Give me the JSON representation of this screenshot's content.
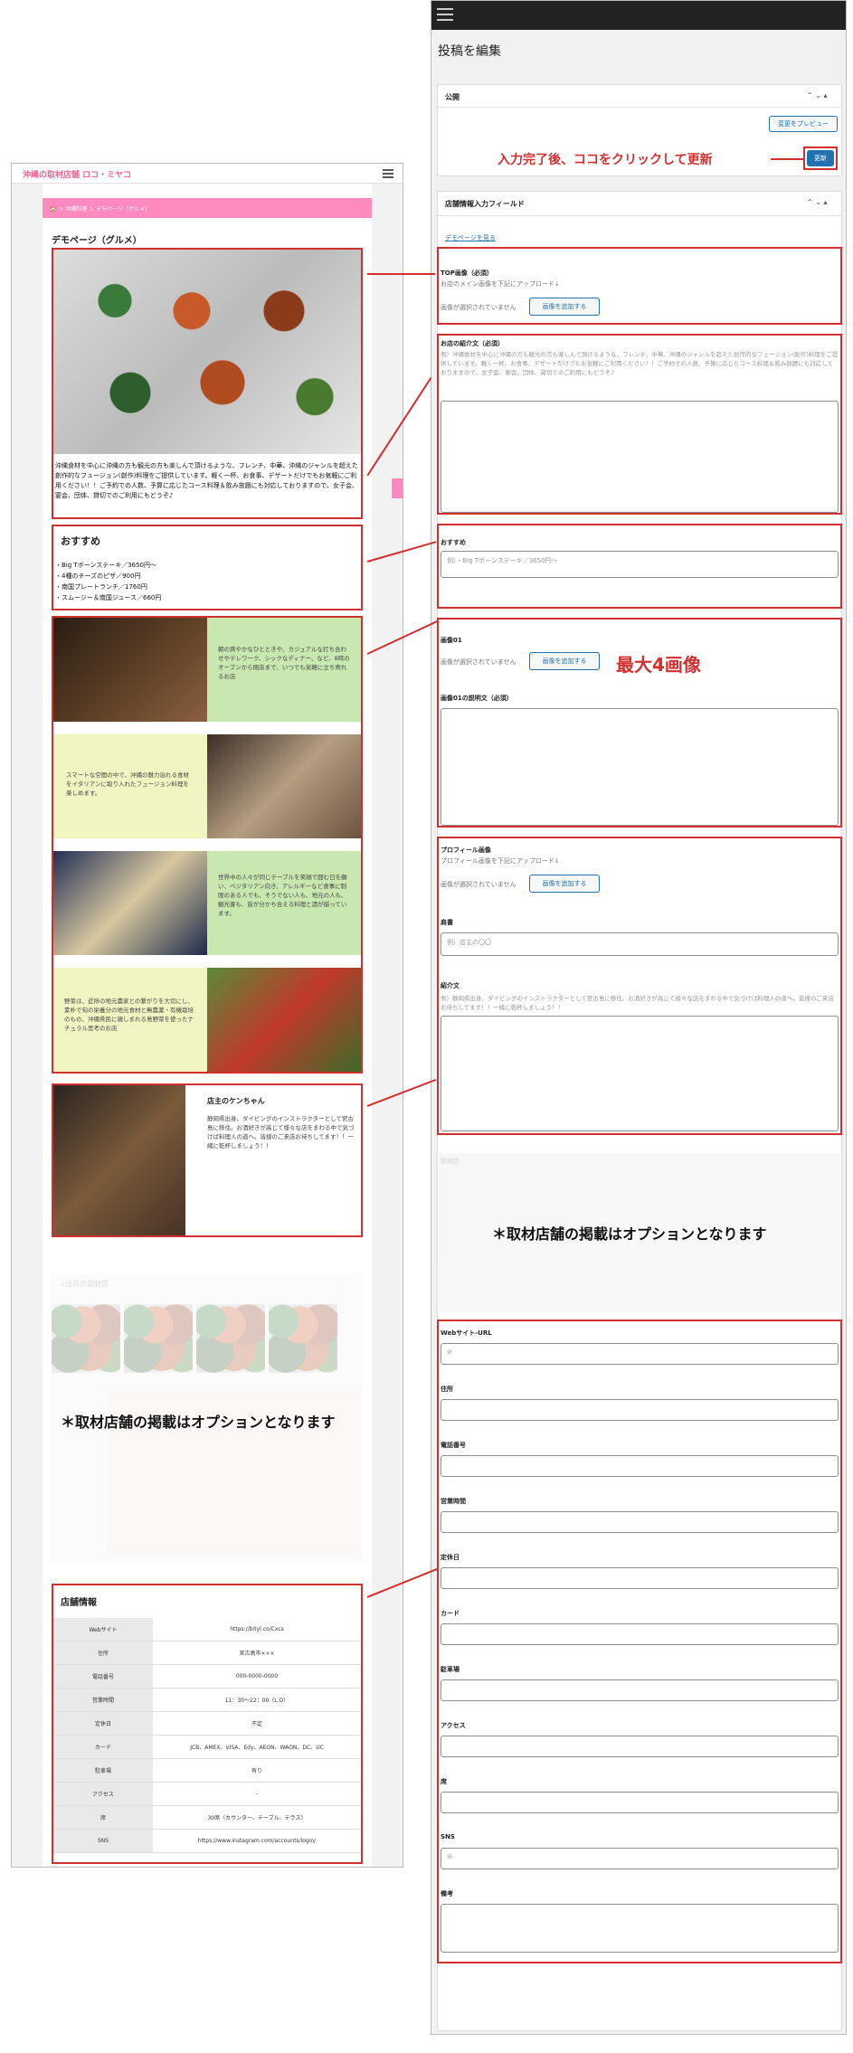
{
  "preview": {
    "logo": "沖縄の取材店舗 ロコ・ミヤコ",
    "breadcrumb": "🏠 ＞ 沖縄料理 ＞ デモページ（グルメ）",
    "page_title": "デモページ（グルメ）",
    "intro": "沖縄食材を中心に沖縄の方も観光の方も楽しんで頂けるような、フレンチ、中華、沖縄のジャンルを超えた創作的なフュージョン(創作)料理をご提供しています。軽く一杯、お食事、デザートだけでもお気軽にご利用ください！！ご予約での人数、予算に応じたコース料理＆飲み放題にも対応しておりますので、女子会、宴会、団体、貸切でのご利用にもどうぞ♪",
    "recommend_title": "おすすめ",
    "recommend_lines": [
      "・Big Tボーンステーキ／3650円～",
      "・4種のチーズのピザ／900円",
      "・南国プレートランチ／1760円",
      "・スムージー＆南国ジュース／660円"
    ],
    "gallery_texts": [
      "朝の爽やかなひとときや、カジュアルな打ち合わせやテレワーク、シックなディナー、など、8時のオープンから閉店まで、いつでも気軽に立ち寄れるお店",
      "スマートな空間の中で、沖縄の魅力溢れる食材をイタリアンに取り入れたフュージョン料理を楽しめます。",
      "世界中の人々が同じテーブルを笑顔で囲む日を願い、ベジタリアン向き、アレルギーなど食事に制限のある人でも、そうでない人も、地元の人も、観光客も、皆が分かち合える料理と酒が揃っています。",
      "野菜は、近所の地元農家との繋がりを大切にし、素朴で旬の栄養分の地元食材と無農薬・有機栽培のもの、沖縄県民に親しまれる島野菜を使ったナチュラル思考のお店"
    ],
    "owner_title": "店主のケンちゃん",
    "owner_text": "静岡県出身。ダイビングのインストラクターとして宮古島に移住。お酒好きが高じて様々な店をまわる中で気づけば料理人の道へ。皆様のご来店お待ちしてます！！一緒に乾杯しましょう！！",
    "faded_title": "♪注目の取材店",
    "option_note": "＊取材店舗の掲載はオプションとなります",
    "shop_title": "店舗情報",
    "shop_rows": [
      {
        "k": "Webサイト",
        "v": "https://bityl.co/Cxcs"
      },
      {
        "k": "住所",
        "v": "宮古島市×××"
      },
      {
        "k": "電話番号",
        "v": "000-0000-0000"
      },
      {
        "k": "営業時間",
        "v": "11：30～22：00（L.O）"
      },
      {
        "k": "定休日",
        "v": "不定"
      },
      {
        "k": "カード",
        "v": "JCB、AMEX、VISA、Edy、AEON、WAON、DC、UC"
      },
      {
        "k": "駐車場",
        "v": "有り"
      },
      {
        "k": "アクセス",
        "v": "-"
      },
      {
        "k": "席",
        "v": "30席（カウンター、テーブル、テラス）"
      },
      {
        "k": "SNS",
        "v": "https://www.instagram.com/accounts/login/"
      }
    ]
  },
  "editor": {
    "title": "投稿を編集",
    "publish_panel": "公開",
    "preview_btn": "変更をプレビュー",
    "update_note": "入力完了後、ココをクリックして更新",
    "update_btn": "更新",
    "fields_panel": "店舗情報入力フィールド",
    "demo_link": "デモページを見る",
    "top_image_label": "TOP画像（必須）",
    "top_image_sub": "お店のメイン画像を下記にアップロード↓",
    "no_image": "画像が選択されていません",
    "add_image_btn": "画像を追加する",
    "intro_label": "お店の紹介文（必須）",
    "intro_sample": "例）沖縄食材を中心に沖縄の方も観光の方も楽しんで頂けるような、フレンチ、中華、沖縄のジャンルを超えた創作的なフュージョン(創作)料理をご提供しています。軽く一杯、お食事、デザートだけでもお気軽にご利用ください！！ご予約での人数、予算に応じたコース料理＆飲み放題にも対応しておりますので、女子会、宴会、団体、貸切でのご利用にもどうぞ♪",
    "recommend_label": "おすすめ",
    "recommend_placeholder": "例）・Big Tボーンステーキ／3650円～",
    "image01_label": "画像01",
    "max_images_note": "最大4画像",
    "image01_desc_label": "画像01の説明文（必須）",
    "profile_image_label": "プロフィール画像",
    "profile_image_sub": "プロフィール画像を下記にアップロード↓",
    "role_label": "肩書",
    "role_placeholder": "例）店主の〇〇",
    "bio_label": "紹介文",
    "bio_sample": "例）静岡県出身。ダイビングのインストラクターとして宮古島に移住。お酒好きが高じて様々な店をまわる中で気づけば料理人の道へ。皆様のご来店お待ちしてます！！一緒に乾杯しましょう！！",
    "faded_label": "取材店",
    "option_note": "＊取材店舗の掲載はオプションとなります",
    "shop_fields": [
      "Webサイト-URL",
      "住所",
      "電話番号",
      "営業時間",
      "定休日",
      "カード",
      "駐車場",
      "アクセス",
      "席",
      "SNS",
      "備考"
    ],
    "link_icon": "⊘"
  }
}
